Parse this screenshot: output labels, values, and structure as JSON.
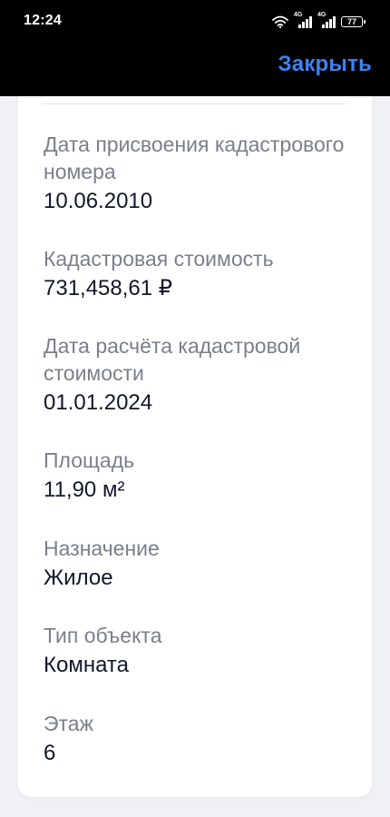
{
  "status_bar": {
    "time": "12:24",
    "network_1": "4G",
    "network_2": "4G",
    "battery": "77"
  },
  "header": {
    "close_label": "Закрыть",
    "accent_color": "#3b82f6"
  },
  "fields": [
    {
      "label": "Дата присвоения кадастрового номера",
      "value": "10.06.2010"
    },
    {
      "label": "Кадастровая стоимость",
      "value": "731,458,61 ₽"
    },
    {
      "label": "Дата расчёта кадастровой стоимости",
      "value": "01.01.2024"
    },
    {
      "label": "Площадь",
      "value": "11,90 м²"
    },
    {
      "label": "Назначение",
      "value": "Жилое"
    },
    {
      "label": "Тип объекта",
      "value": "Комната"
    },
    {
      "label": "Этаж",
      "value": "6"
    }
  ]
}
